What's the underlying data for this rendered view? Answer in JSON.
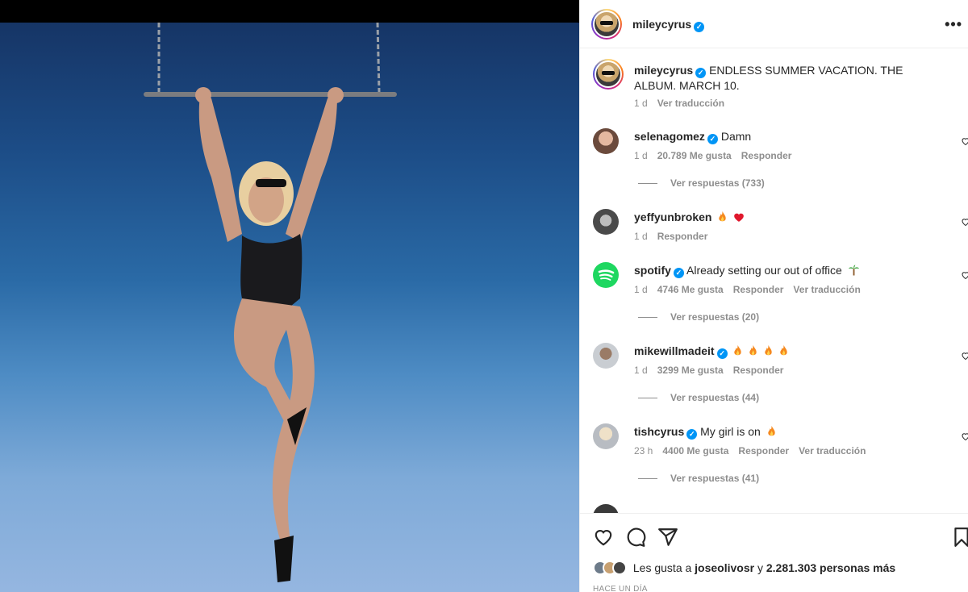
{
  "post": {
    "author": "mileycyrus",
    "caption": "ENDLESS SUMMER VACATION. THE ALBUM. MARCH 10.",
    "caption_age": "1 d",
    "caption_translate": "Ver traducción"
  },
  "header": {
    "username": "mileycyrus",
    "more": "•••"
  },
  "comments": [
    {
      "user": "selenagomez",
      "verified": true,
      "text": "Damn",
      "emoji": [],
      "age": "1 d",
      "likes": "20.789 Me gusta",
      "reply": "Responder",
      "translate": "",
      "replies": "Ver respuestas (733)"
    },
    {
      "user": "yeffyunbroken",
      "verified": false,
      "text": "",
      "emoji": [
        "fire",
        "red-heart"
      ],
      "age": "1 d",
      "likes": "",
      "reply": "Responder",
      "translate": "",
      "replies": ""
    },
    {
      "user": "spotify",
      "verified": true,
      "text": "Already setting our out of office",
      "emoji": [
        "palm-tree"
      ],
      "age": "1 d",
      "likes": "4746 Me gusta",
      "reply": "Responder",
      "translate": "Ver traducción",
      "replies": "Ver respuestas (20)"
    },
    {
      "user": "mikewillmadeit",
      "verified": true,
      "text": "",
      "emoji": [
        "fire",
        "fire",
        "fire",
        "fire"
      ],
      "age": "1 d",
      "likes": "3299 Me gusta",
      "reply": "Responder",
      "translate": "",
      "replies": "Ver respuestas (44)"
    },
    {
      "user": "tishcyrus",
      "verified": true,
      "text": "My girl is on",
      "emoji": [
        "fire"
      ],
      "age": "23 h",
      "likes": "4400 Me gusta",
      "reply": "Responder",
      "translate": "Ver traducción",
      "replies": "Ver respuestas (41)"
    }
  ],
  "likes_bar": {
    "prefix": "Les gusta a",
    "user": "joseolivosr",
    "middle": "y",
    "count": "2.281.303 personas más",
    "ago": "HACE UN DÍA"
  },
  "icons": [
    "like-icon",
    "comment-icon",
    "share-icon",
    "save-icon",
    "more-icon",
    "verified-badge-icon",
    "fire-emoji",
    "red-heart-emoji",
    "palm-tree-emoji"
  ],
  "colors": {
    "verified": "#0095f6",
    "muted": "#8e8e8e",
    "text": "#262626",
    "border": "#efefef"
  }
}
